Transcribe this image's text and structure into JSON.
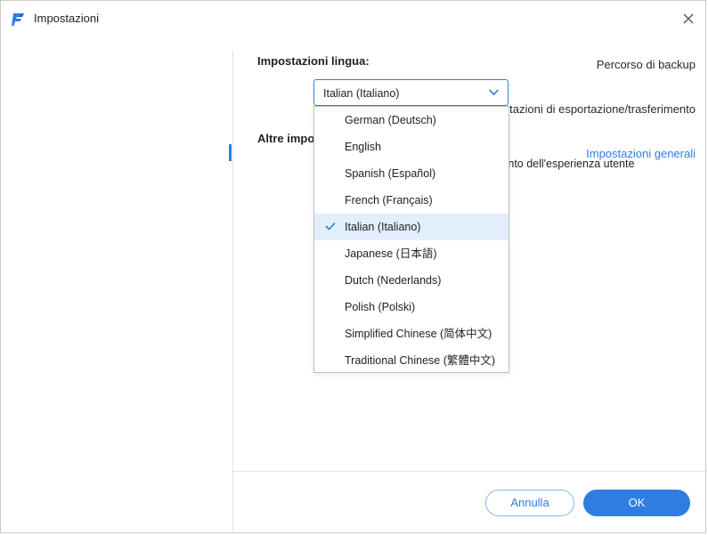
{
  "window": {
    "title": "Impostazioni"
  },
  "sidebar": {
    "items": [
      {
        "label": "Percorso di backup"
      },
      {
        "label": "Impostazioni di esportazione/trasferimento"
      },
      {
        "label": "Impostazioni generali",
        "active": true
      }
    ]
  },
  "language_section": {
    "title": "Impostazioni lingua:",
    "selected": "Italian (Italiano)",
    "options": [
      "German (Deutsch)",
      "English",
      "Spanish (Español)",
      "French (Français)",
      "Italian (Italiano)",
      "Japanese (日本語)",
      "Dutch (Nederlands)",
      "Polish (Polski)",
      "Simplified Chinese (简体中文)",
      "Traditional Chinese (繁體中文)"
    ]
  },
  "other_section": {
    "title": "Altre impos",
    "description": "mento dell'esperienza utente"
  },
  "footer": {
    "cancel_label": "Annulla",
    "ok_label": "OK"
  },
  "colors": {
    "accent": "#2f7de1",
    "selected_row": "#e2eefc"
  },
  "icons": {
    "logo": "app-logo-icon",
    "close": "close-icon",
    "dropdown": "chevron-down-icon",
    "check": "check-icon"
  }
}
